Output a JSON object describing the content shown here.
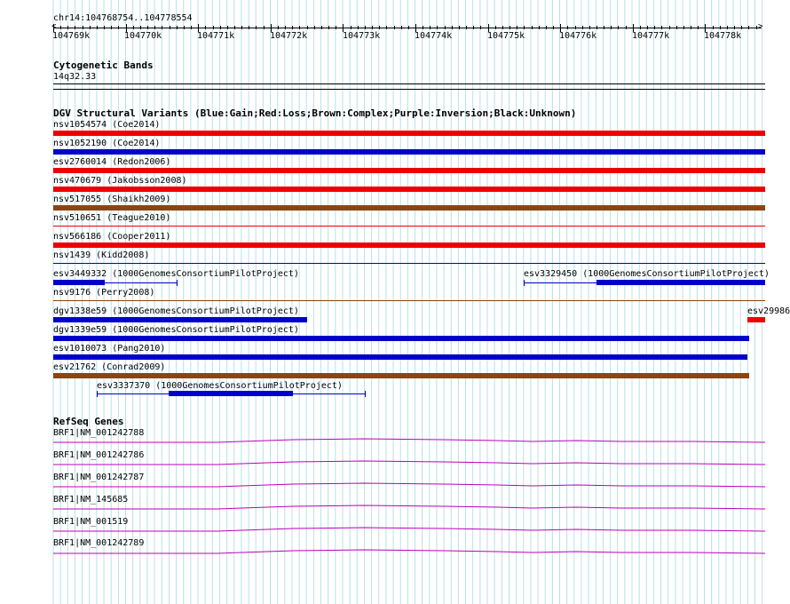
{
  "ruler": {
    "location": "chr14:104768754..104778554",
    "ticks": [
      "104769k",
      "104770k",
      "104771k",
      "104772k",
      "104773k",
      "104774k",
      "104775k",
      "104776k",
      "104777k",
      "104778k"
    ]
  },
  "cyto": {
    "title": "Cytogenetic Bands",
    "band": "14q32.33"
  },
  "dgv": {
    "title": "DGV Structural Variants (Blue:Gain;Red:Loss;Brown:Complex;Purple:Inversion;Black:Unknown)",
    "colors": {
      "gain": "#0000cc",
      "loss": "#ee0000",
      "complex": "#8b4513",
      "line": "#0000cc"
    },
    "labels": {
      "nsv1054574": "nsv1054574 (Coe2014)",
      "nsv1052190": "nsv1052190 (Coe2014)",
      "esv2760014": "esv2760014 (Redon2006)",
      "nsv470679": "nsv470679 (Jakobsson2008)",
      "nsv517055": "nsv517055 (Shaikh2009)",
      "nsv510651": "nsv510651 (Teague2010)",
      "nsv566186": "nsv566186 (Cooper2011)",
      "nsv1439": "nsv1439 (Kidd2008)",
      "esv3449332": "esv3449332 (1000GenomesConsortiumPilotProject)",
      "esv3329450": "esv3329450 (1000GenomesConsortiumPilotProject)",
      "nsv9176": "nsv9176 (Perry2008)",
      "dgv1338e59": "dgv1338e59 (1000GenomesConsortiumPilotProject)",
      "esv29986": "esv29986",
      "dgv1339e59": "dgv1339e59 (1000GenomesConsortiumPilotProject)",
      "esv1010073": "esv1010073 (Pang2010)",
      "esv21762": "esv21762 (Conrad2009)",
      "esv3337370": "esv3337370 (1000GenomesConsortiumPilotProject)"
    }
  },
  "refseq": {
    "title": "RefSeq Genes",
    "color": "#bb00bb",
    "genes": [
      "BRF1|NM_001242788",
      "BRF1|NM_001242786",
      "BRF1|NM_001242787",
      "BRF1|NM_145685",
      "BRF1|NM_001519",
      "BRF1|NM_001242789"
    ]
  }
}
